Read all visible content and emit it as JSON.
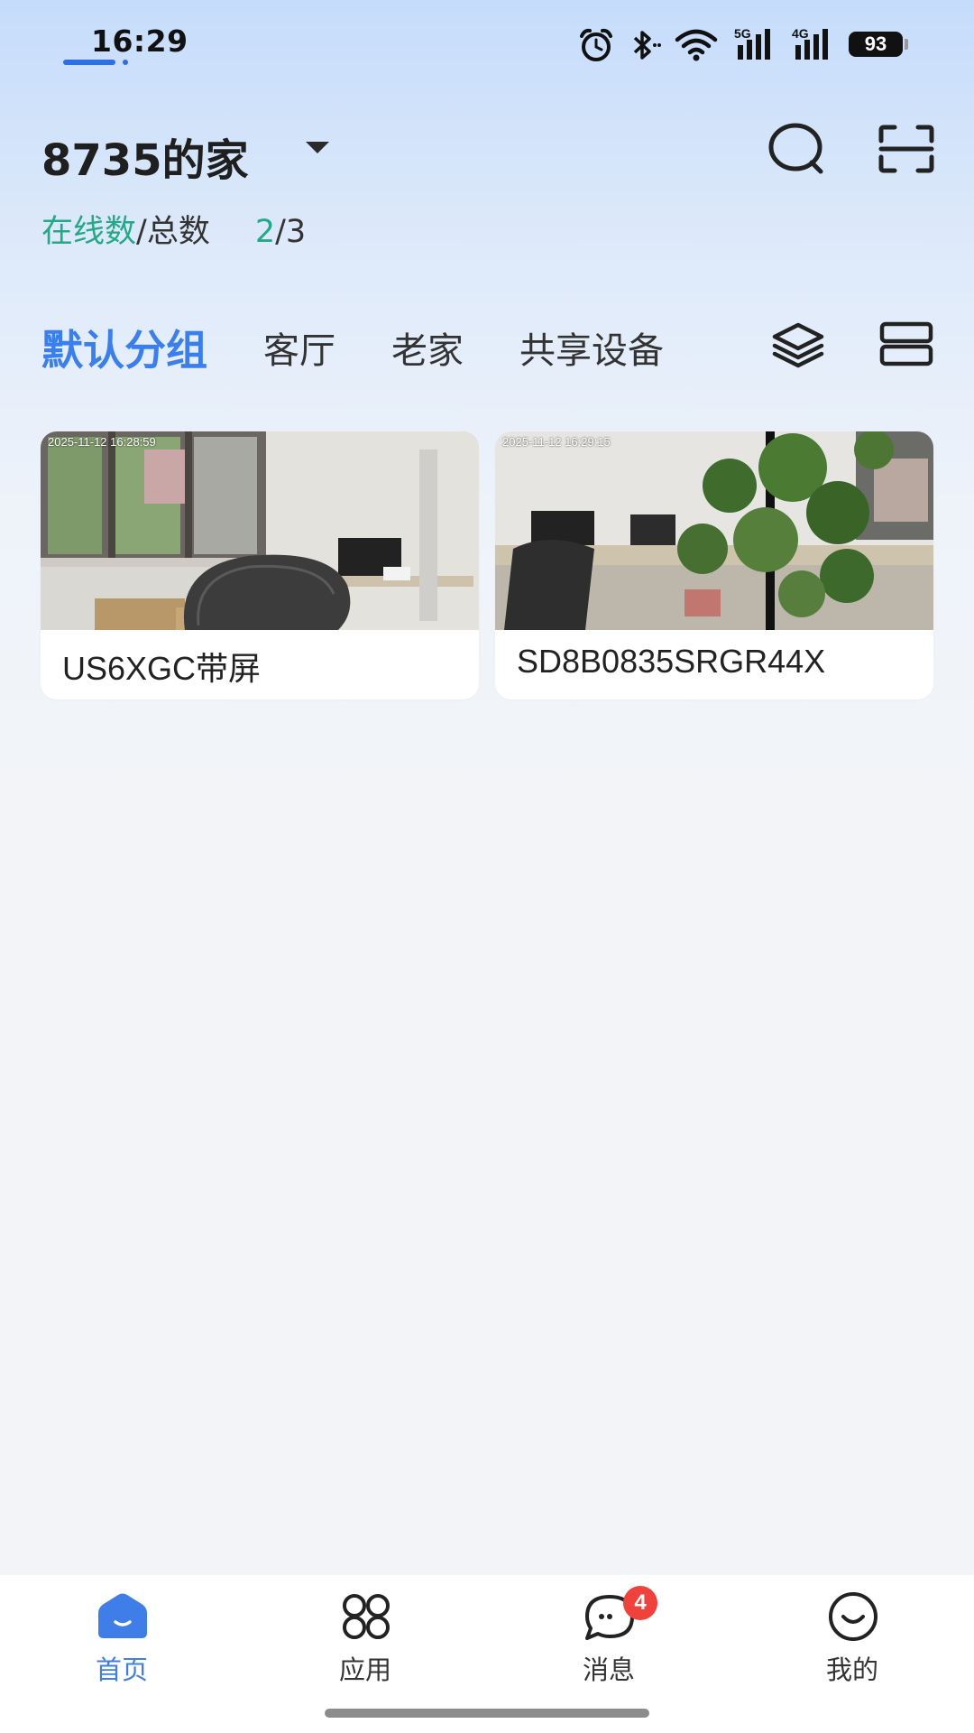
{
  "status_bar": {
    "time": "16:29",
    "battery": "93",
    "net1": "5G",
    "net2": "4G",
    "icons": [
      "alarm-icon",
      "bluetooth-icon",
      "wifi-icon",
      "signal-5g-icon",
      "signal-4g-icon",
      "battery-icon"
    ]
  },
  "header": {
    "home_name": "8735的家",
    "online_label": "在线数",
    "separator": "/",
    "total_label": "总数",
    "online_count": "2",
    "count_separator": "/",
    "total_count": "3",
    "icons": [
      "search-icon",
      "scan-icon"
    ]
  },
  "tabs": [
    {
      "label": "默认分组",
      "active": true
    },
    {
      "label": "客厅",
      "active": false
    },
    {
      "label": "老家",
      "active": false
    },
    {
      "label": "共享设备",
      "active": false
    }
  ],
  "tab_actions": [
    "layers-icon",
    "list-layout-icon"
  ],
  "devices": [
    {
      "timestamp": "2025-11-12 16:28:59",
      "name": "US6XGC带屏"
    },
    {
      "timestamp": "2025-11-12 16:29:15",
      "name": "SD8B0835SRGR44X"
    }
  ],
  "bottom_nav": [
    {
      "label": "首页",
      "icon": "home-icon",
      "active": true
    },
    {
      "label": "应用",
      "icon": "apps-icon",
      "active": false
    },
    {
      "label": "消息",
      "icon": "message-icon",
      "active": false,
      "badge": "4"
    },
    {
      "label": "我的",
      "icon": "profile-icon",
      "active": false
    }
  ],
  "colors": {
    "accent": "#3a7ff0",
    "online_green": "#23a986",
    "badge_red": "#f0413b"
  }
}
